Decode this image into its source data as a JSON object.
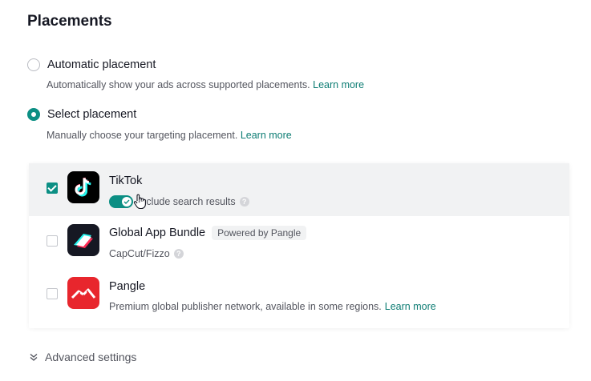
{
  "section": {
    "title": "Placements"
  },
  "automatic": {
    "label": "Automatic placement",
    "description": "Automatically show your ads across supported placements.",
    "link": "Learn more",
    "selected": false
  },
  "select": {
    "label": "Select placement",
    "description": "Manually choose your targeting placement.",
    "link": "Learn more",
    "selected": true
  },
  "placements": [
    {
      "name": "TikTok",
      "checked": true,
      "toggle_label": "Include search results",
      "toggle_on": true,
      "icon": "tiktok-logo"
    },
    {
      "name": "Global App Bundle",
      "badge": "Powered by Pangle",
      "checked": false,
      "subtitle": "CapCut/Fizzo",
      "icon": "global-app-bundle-logo"
    },
    {
      "name": "Pangle",
      "checked": false,
      "subtitle": "Premium global publisher network, available in some regions.",
      "link": "Learn more",
      "icon": "pangle-logo"
    }
  ],
  "advanced": {
    "label": "Advanced settings"
  },
  "colors": {
    "accent": "#0c8f84",
    "link": "#0c7c73",
    "pangle_red": "#e8262d"
  }
}
